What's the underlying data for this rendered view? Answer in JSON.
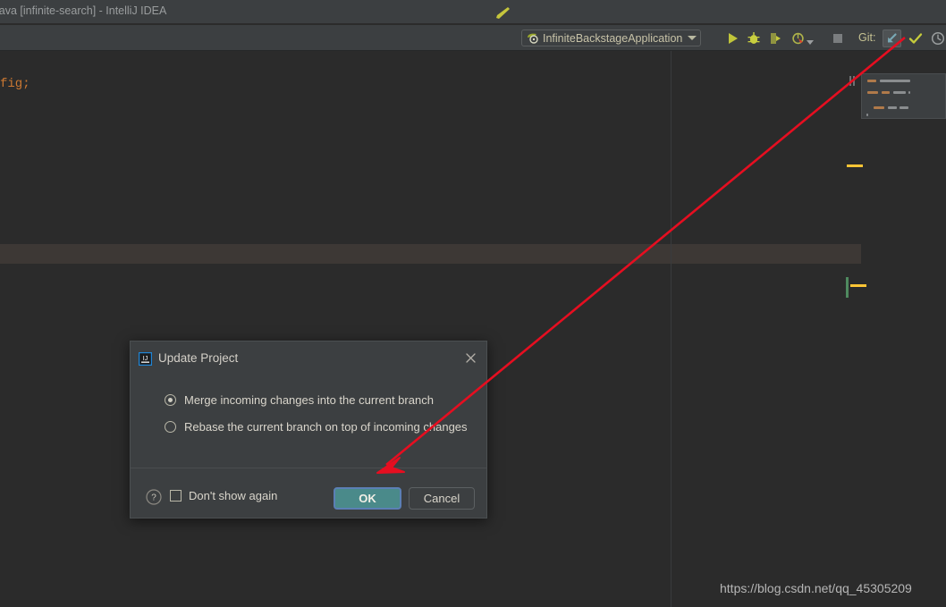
{
  "window": {
    "title": "java [infinite-search] - IntelliJ IDEA"
  },
  "toolbar": {
    "build_icon": "hammer-icon",
    "run_config": {
      "label": "InfiniteBackstageApplication",
      "icon": "spring-boot-leaf-icon",
      "chevron": "chevron-down-icon"
    },
    "actions": [
      {
        "name": "run-button",
        "icon": "play-icon",
        "color": "#c0c53a"
      },
      {
        "name": "debug-button",
        "icon": "bug-icon",
        "color": "#c9cf3f"
      },
      {
        "name": "run-with-coverage-button",
        "icon": "coverage-icon",
        "color": "#b7bb4a"
      },
      {
        "name": "profiler-button",
        "icon": "profiler-icon",
        "color": "#b0b44a"
      },
      {
        "name": "stop-button",
        "icon": "stop-square-icon",
        "color": "#7a7d7f"
      }
    ],
    "git": {
      "label": "Git:",
      "update_project_icon": "update-project-arrow-icon",
      "commit_icon": "checkmark-icon",
      "history_icon": "clock-icon"
    }
  },
  "editor": {
    "code_snippet": "fig;",
    "minimap_lines": [
      {
        "x": 6,
        "y": 6,
        "w": 10,
        "color": "#b07a4a"
      },
      {
        "x": 20,
        "y": 6,
        "w": 34,
        "color": "#8a8d8f"
      },
      {
        "x": 6,
        "y": 19,
        "w": 12,
        "color": "#b07a4a"
      },
      {
        "x": 22,
        "y": 19,
        "w": 9,
        "color": "#b07a4a"
      },
      {
        "x": 35,
        "y": 19,
        "w": 14,
        "color": "#8a8d8f"
      },
      {
        "x": 52,
        "y": 19,
        "w": 2,
        "color": "#8a8d8f"
      },
      {
        "x": 13,
        "y": 36,
        "w": 12,
        "color": "#b07a4a"
      },
      {
        "x": 29,
        "y": 36,
        "w": 10,
        "color": "#8a8d8f"
      },
      {
        "x": 42,
        "y": 36,
        "w": 10,
        "color": "#8a8d8f"
      },
      {
        "x": 5,
        "y": 44,
        "w": 2,
        "color": "#8a8d8f"
      }
    ]
  },
  "dialog": {
    "title": "Update Project",
    "logo_icon": "intellij-idea-logo-icon",
    "close_icon": "close-icon",
    "options": [
      {
        "label": "Merge incoming changes into the current branch",
        "selected": true
      },
      {
        "label": "Rebase the current branch on top of incoming changes",
        "selected": false
      }
    ],
    "help_icon": "help-question-icon",
    "dont_show_again": {
      "label": "Don't show again",
      "checked": false
    },
    "ok_label": "OK",
    "cancel_label": "Cancel"
  },
  "annotation": {
    "arrow_color": "#e60e20"
  },
  "watermark": {
    "text": "https://blog.csdn.net/qq_45305209"
  },
  "colors": {
    "editor_bg": "#2b2b2b",
    "chrome_bg": "#3c3f41",
    "ok_button": "#4a8a8a",
    "focus_ring": "#5b7fb5",
    "marker_yellow": "#ffc535",
    "vcs_green": "#4f8a5f"
  }
}
